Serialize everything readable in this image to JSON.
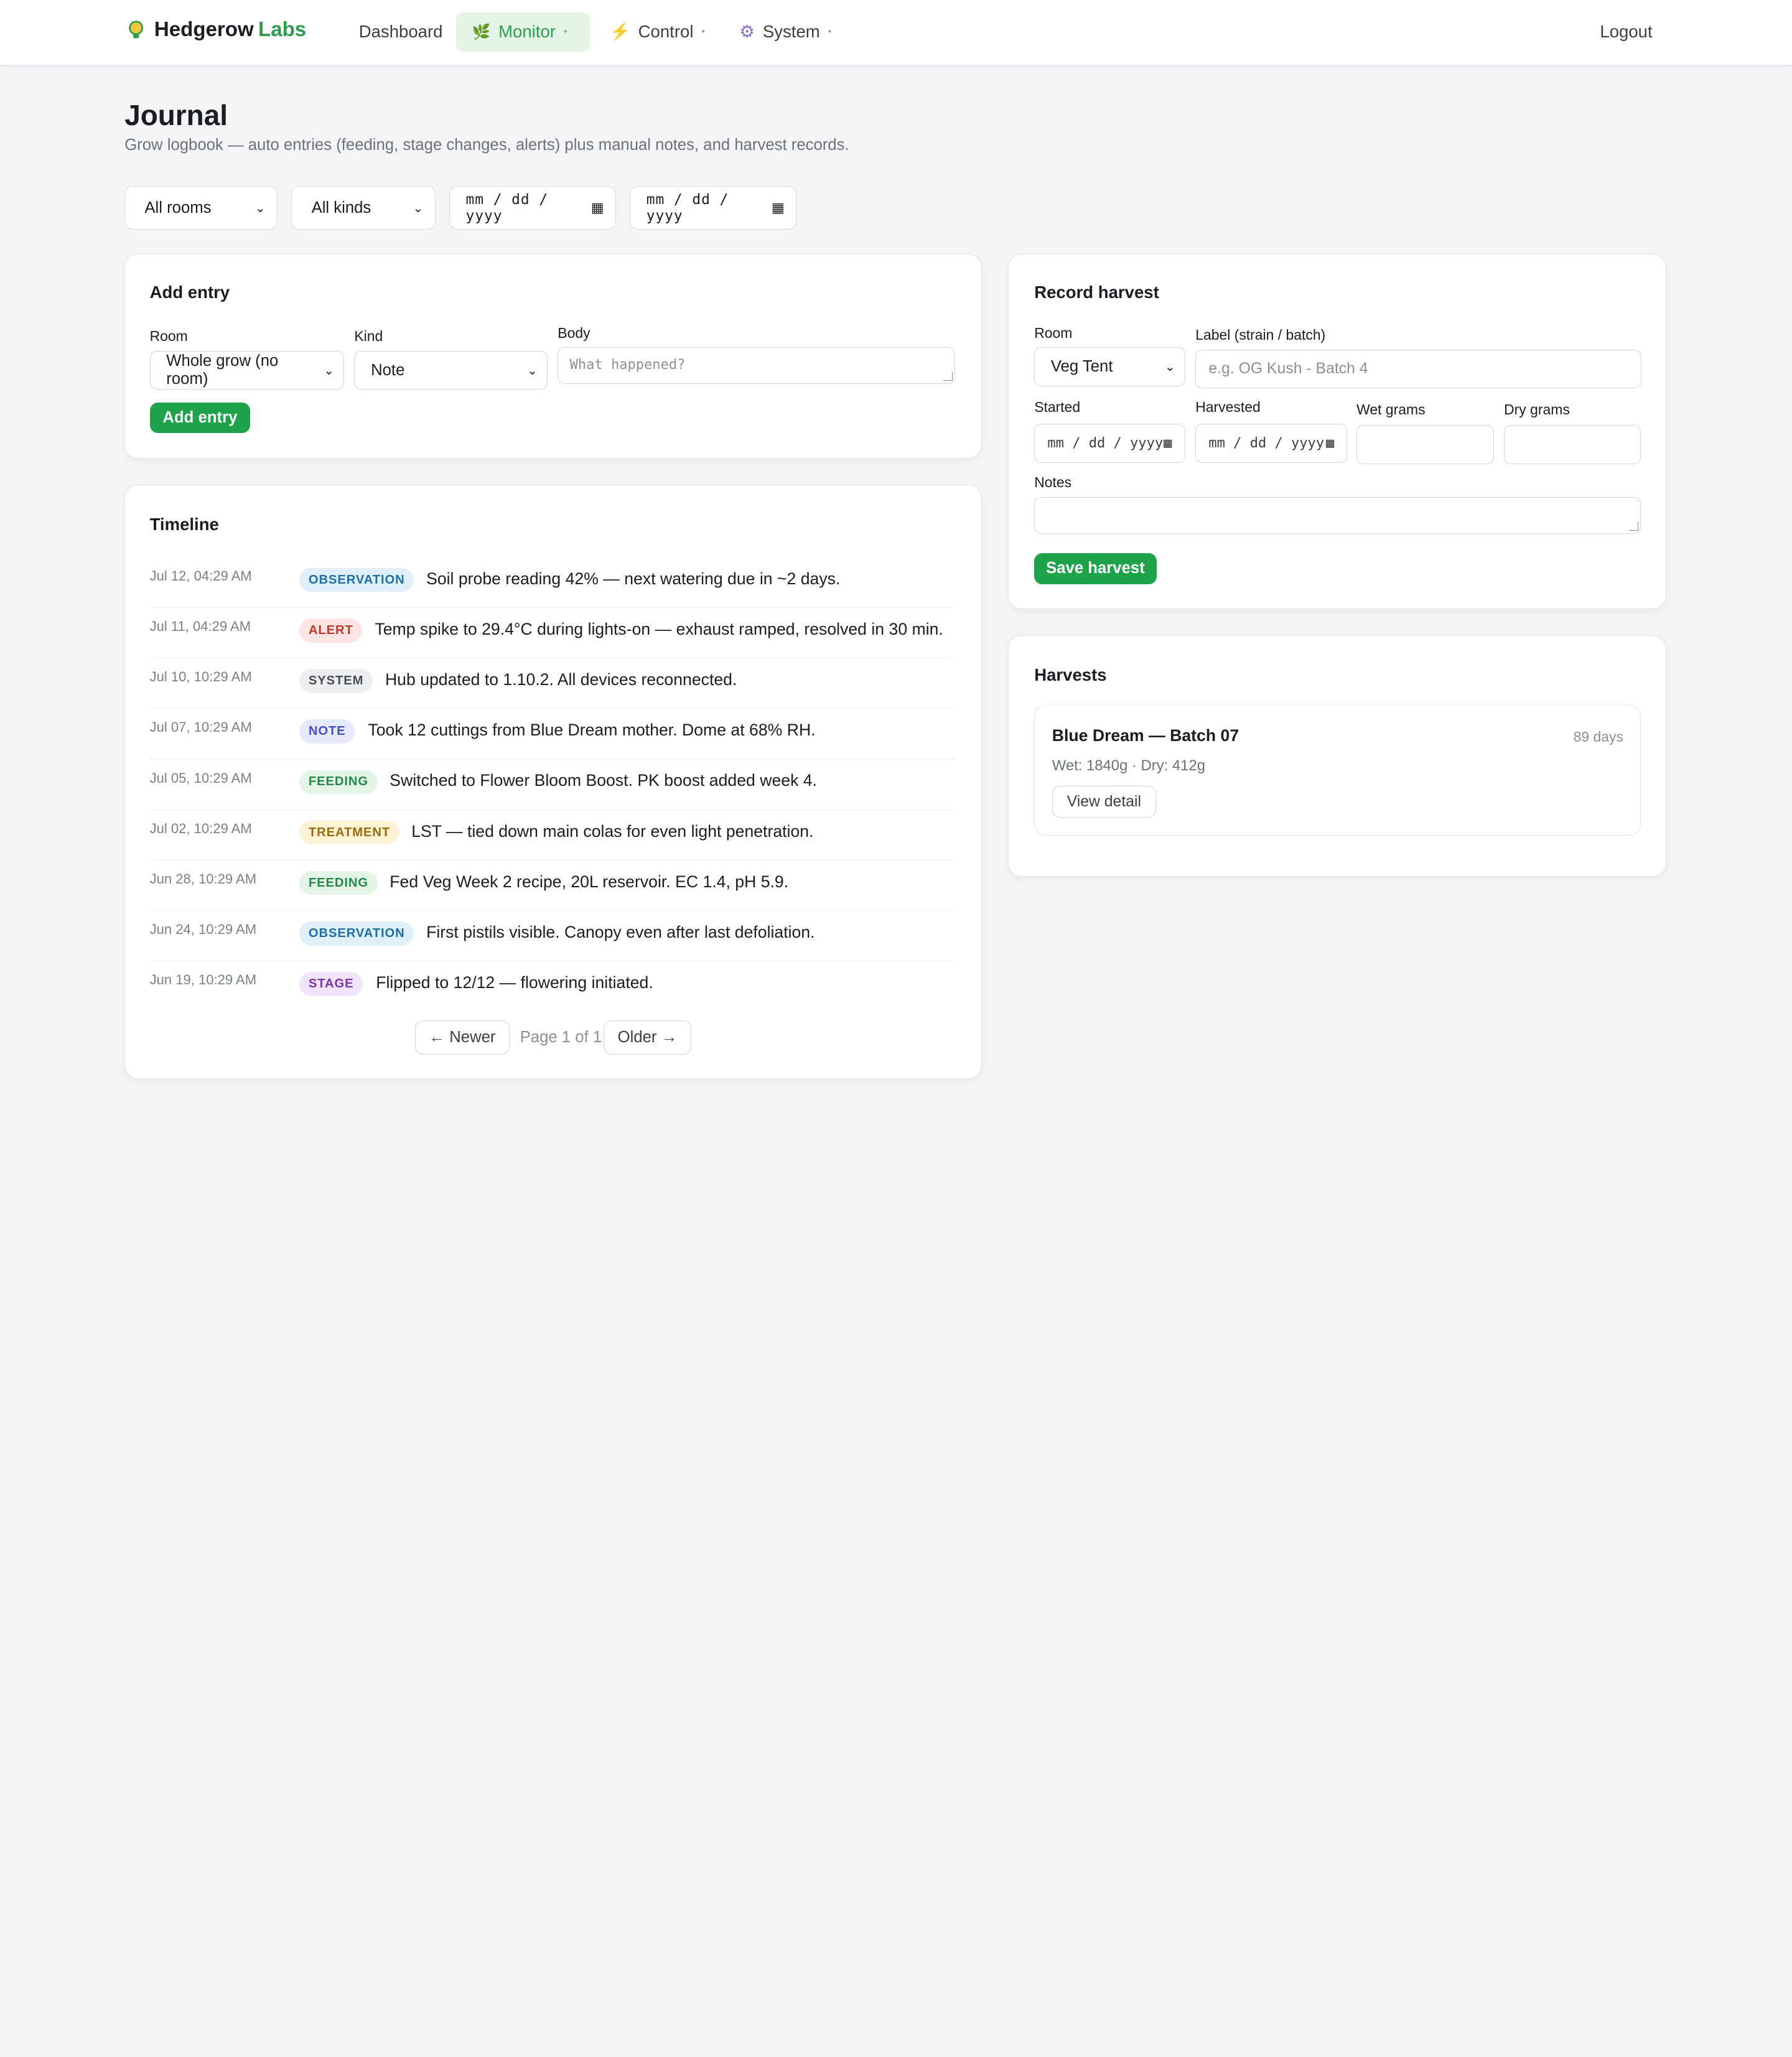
{
  "nav": {
    "brand_part1": "Hedgerow",
    "brand_part2": "Labs",
    "items": [
      {
        "label": "Dashboard"
      },
      {
        "label": "Monitor"
      },
      {
        "label": "Control"
      },
      {
        "label": "System"
      }
    ],
    "logout": "Logout",
    "active_color": "#2e9b4e"
  },
  "page": {
    "title": "Journal",
    "subtitle": "Grow logbook — auto entries (feeding, stage changes, alerts) plus manual notes, and harvest records."
  },
  "filters": {
    "room": "All rooms",
    "kind": "All kinds",
    "date_from": "mm / dd / yyyy",
    "date_to": "mm / dd / yyyy"
  },
  "add_entry": {
    "title": "Add entry",
    "room_label": "Room",
    "room_value": "Whole grow (no room)",
    "kind_label": "Kind",
    "kind_value": "Note",
    "body_label": "Body",
    "body_placeholder": "What happened?",
    "button": "Add entry"
  },
  "timeline": {
    "title": "Timeline",
    "entries": [
      {
        "time": "Jul 12, 04:29 AM",
        "kind": "OBSERVATION",
        "text": "Soil probe reading 42% — next watering due in ~2 days."
      },
      {
        "time": "Jul 11, 04:29 AM",
        "kind": "ALERT",
        "text": "Temp spike to 29.4°C during lights-on — exhaust ramped, resolved in 30 min."
      },
      {
        "time": "Jul 10, 10:29 AM",
        "kind": "SYSTEM",
        "text": "Hub updated to 1.10.2. All devices reconnected."
      },
      {
        "time": "Jul 07, 10:29 AM",
        "kind": "NOTE",
        "text": "Took 12 cuttings from Blue Dream mother. Dome at 68% RH."
      },
      {
        "time": "Jul 05, 10:29 AM",
        "kind": "FEEDING",
        "text": "Switched to Flower Bloom Boost. PK boost added week 4."
      },
      {
        "time": "Jul 02, 10:29 AM",
        "kind": "TREATMENT",
        "text": "LST — tied down main colas for even light penetration."
      },
      {
        "time": "Jun 28, 10:29 AM",
        "kind": "FEEDING",
        "text": "Fed Veg Week 2 recipe, 20L reservoir. EC 1.4, pH 5.9."
      },
      {
        "time": "Jun 24, 10:29 AM",
        "kind": "OBSERVATION",
        "text": "First pistils visible. Canopy even after last defoliation."
      },
      {
        "time": "Jun 19, 10:29 AM",
        "kind": "STAGE",
        "text": "Flipped to 12/12 — flowering initiated."
      }
    ],
    "newer": "← Newer",
    "page_info": "Page 1 of 1",
    "older": "Older →"
  },
  "record_harvest": {
    "title": "Record harvest",
    "room_label": "Room",
    "room_value": "Veg Tent",
    "label_label": "Label (strain / batch)",
    "label_placeholder": "e.g. OG Kush - Batch 4",
    "started_label": "Started",
    "started_value": "mm / dd / yyyy",
    "harvested_label": "Harvested",
    "harvested_value": "mm / dd / yyyy",
    "wet_label": "Wet grams",
    "dry_label": "Dry grams",
    "notes_label": "Notes",
    "button": "Save harvest"
  },
  "harvests": {
    "title": "Harvests",
    "items": [
      {
        "name": "Blue Dream — Batch 07",
        "days": "89 days",
        "weights": "Wet: 1840g · Dry: 412g",
        "button": "View detail"
      }
    ]
  }
}
